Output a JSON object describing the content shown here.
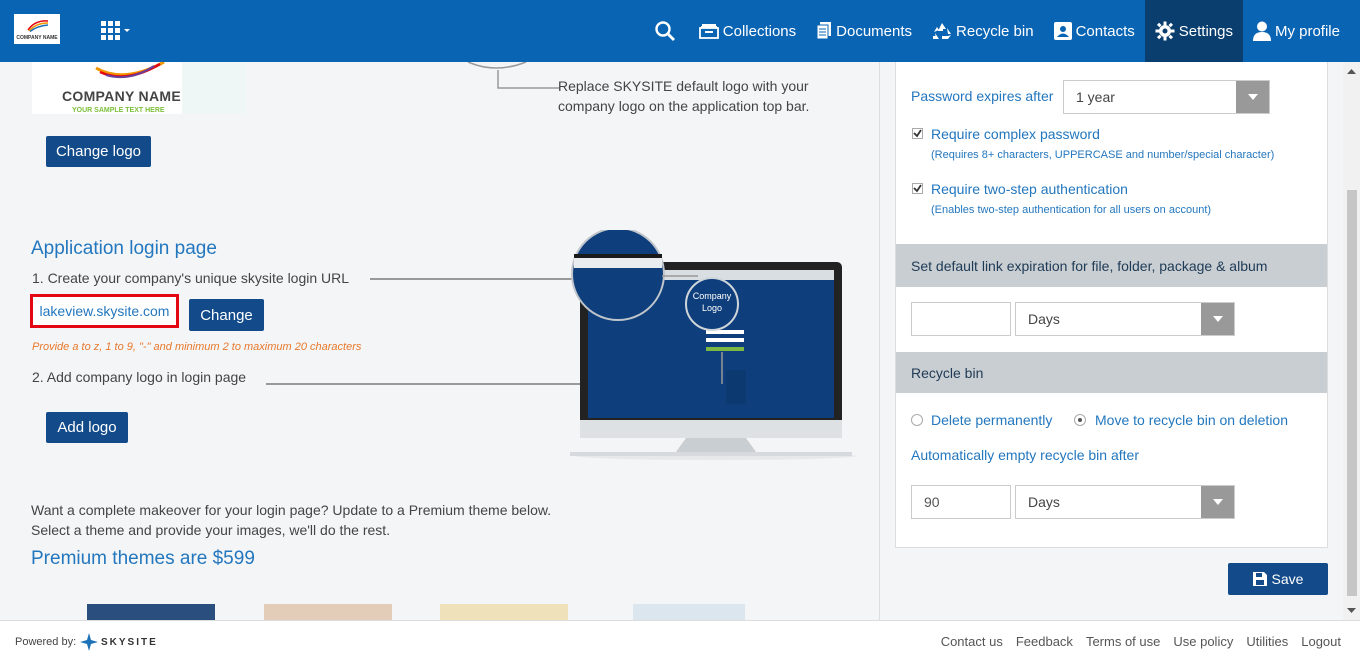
{
  "topbar": {
    "logo_text": "COMPANY NAME",
    "nav": [
      {
        "label": "Collections",
        "icon": "collections-icon"
      },
      {
        "label": "Documents",
        "icon": "documents-icon"
      },
      {
        "label": "Recycle bin",
        "icon": "recycle-icon"
      },
      {
        "label": "Contacts",
        "icon": "contacts-icon"
      },
      {
        "label": "Settings",
        "icon": "gear-icon",
        "active": true
      },
      {
        "label": "My profile",
        "icon": "user-icon"
      }
    ]
  },
  "branding": {
    "company_name": "COMPANY NAME",
    "company_sub": "YOUR SAMPLE TEXT HERE",
    "replace_text": "Replace SKYSITE default logo with your company logo on the application top bar.",
    "change_logo": "Change logo"
  },
  "login_page": {
    "title": "Application login page",
    "step1": "1. Create your company's unique skysite login URL",
    "url": "lakeview.skysite.com",
    "change": "Change",
    "hint": "Provide a to z, 1 to 9, \"-\" and minimum 2 to maximum 20 characters",
    "step2": "2. Add company logo in login page",
    "add_logo": "Add logo",
    "monitor_label_line1": "Company",
    "monitor_label_line2": "Logo"
  },
  "premium": {
    "line1": "Want a complete makeover for your login page? Update to a Premium theme below.",
    "line2": "Select a theme and provide your images, we'll do the rest.",
    "title": "Premium themes are $599"
  },
  "security": {
    "password_expires_label": "Password expires after",
    "password_expires_value": "1 year",
    "complex_label": "Require complex password",
    "complex_hint": "(Requires 8+ characters, UPPERCASE and number/special character)",
    "complex_checked": true,
    "twostep_label": "Require two-step authentication",
    "twostep_hint": "(Enables two-step authentication for all users on account)",
    "twostep_checked": true
  },
  "link_expiration": {
    "title": "Set default link expiration for file, folder, package & album",
    "value": "",
    "unit": "Days"
  },
  "recycle": {
    "title": "Recycle bin",
    "opt_delete": "Delete permanently",
    "opt_move": "Move to recycle bin on deletion",
    "selected": "move",
    "auto_label": "Automatically empty recycle bin after",
    "auto_value": "90",
    "auto_unit": "Days"
  },
  "save_label": "Save",
  "footer": {
    "powered_by": "Powered by:",
    "brand": "SKYSITE",
    "links": [
      "Contact us",
      "Feedback",
      "Terms of use",
      "Use policy",
      "Utilities",
      "Logout"
    ]
  },
  "colors": {
    "topbar": "#0a64b4",
    "active_nav": "#0a3e6e",
    "button": "#124a8a",
    "link": "#2377be",
    "highlight": "#e30613",
    "hint": "#e8782b"
  }
}
